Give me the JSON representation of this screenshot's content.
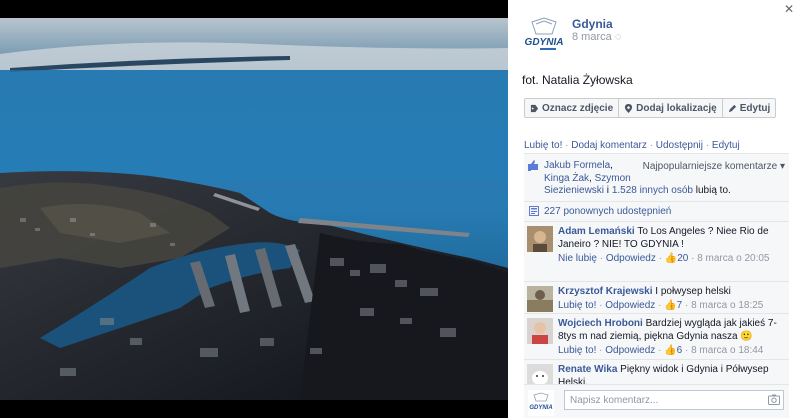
{
  "photo": {
    "alt": ""
  },
  "post": {
    "page_name": "Gdynia",
    "date": "8 marca",
    "caption": "fot. Natalia Żyłowska",
    "logo_text": "GDYNIA",
    "logo_icon": "gdynia-logo"
  },
  "actions": [
    {
      "label": "Oznacz zdjęcie",
      "icon": "tag-icon"
    },
    {
      "label": "Dodaj lokalizację",
      "icon": "location-pin-icon"
    },
    {
      "label": "Edytuj",
      "icon": "pencil-icon"
    }
  ],
  "links": {
    "like": "Lubię to!",
    "comment": "Dodaj komentarz",
    "share": "Udostępnij",
    "edit": "Edytuj",
    "sep": " · "
  },
  "likes": {
    "name1": "Jakub Formela",
    "name2": "Kinga Żak",
    "name3": "Szymon",
    "name3b": "Siezieniewski",
    "others": "1.528 innych osób",
    "suffix": "lubią to.",
    "sort_label": "Najpopularniejsze komentarze"
  },
  "shares": {
    "text": "227 ponownych udostępnień"
  },
  "comments": [
    {
      "author": "Adam Lemański",
      "text": "To Los Angeles ? Niee Rio de Janeiro ? NIE! TO GDYNIA !",
      "like_label": "Nie lubię",
      "reply_label": "Odpowiedz",
      "likes": "20",
      "time": "8 marca o 20:05"
    },
    {
      "author": "Krzysztof Krajewski",
      "text": "I połwysep helski",
      "like_label": "Lubię to!",
      "reply_label": "Odpowiedz",
      "likes": "7",
      "time": "8 marca o 18:25"
    },
    {
      "author": "Wojciech Hroboni",
      "text": "Bardziej wygląda jak jakieś 7-8tys m nad ziemią, piękna Gdynia nasza 🙂",
      "like_label": "Lubię to!",
      "reply_label": "Odpowiedz",
      "likes": "6",
      "time": "8 marca o 18:44"
    },
    {
      "author": "Renate Wika",
      "text": "Piękny widok i Gdynia i Półwysep Helski.",
      "like_label": "",
      "reply_label": "",
      "likes": "",
      "time": ""
    }
  ],
  "composer": {
    "placeholder": "Napisz komentarz..."
  },
  "colors": {
    "link": "#3b5998",
    "meta": "#9197a3",
    "panel_bg": "#f6f7f9"
  }
}
